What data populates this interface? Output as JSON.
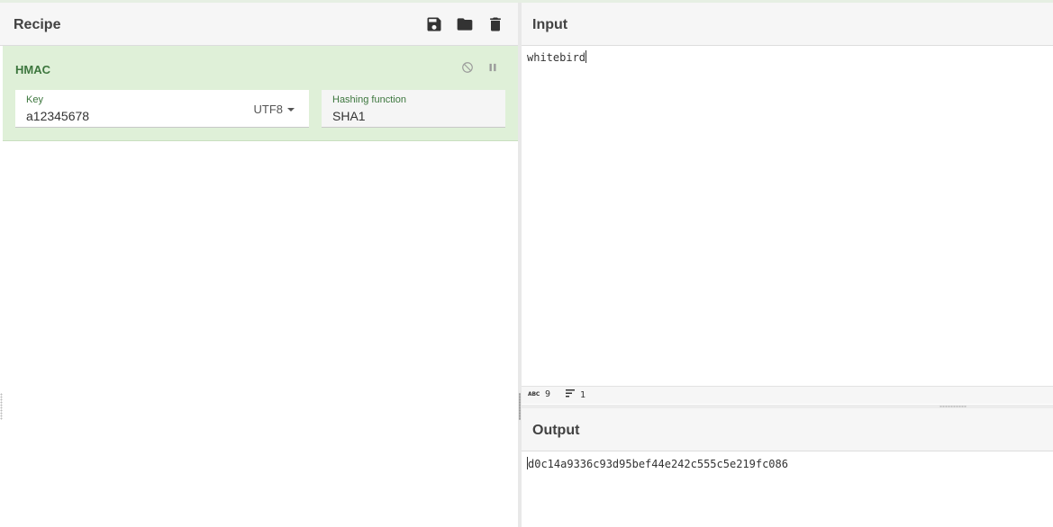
{
  "recipe": {
    "title": "Recipe",
    "icons": [
      "save-icon",
      "folder-icon",
      "trash-icon"
    ],
    "operation": {
      "name": "HMAC",
      "controls": [
        "disable-icon",
        "pause-icon"
      ],
      "key": {
        "label": "Key",
        "value": "a12345678",
        "encoding": "UTF8"
      },
      "hashing": {
        "label": "Hashing function",
        "value": "SHA1"
      }
    }
  },
  "input": {
    "title": "Input",
    "text": "whitebird",
    "status": {
      "chars": "9",
      "lines": "1"
    }
  },
  "output": {
    "title": "Output",
    "text": "d0c14a9336c93d95bef44e242c555c5e219fc086"
  },
  "colors": {
    "operation_bg": "#dff0d8",
    "operation_text": "#3c763d",
    "header_bg": "#f6f6f6"
  }
}
